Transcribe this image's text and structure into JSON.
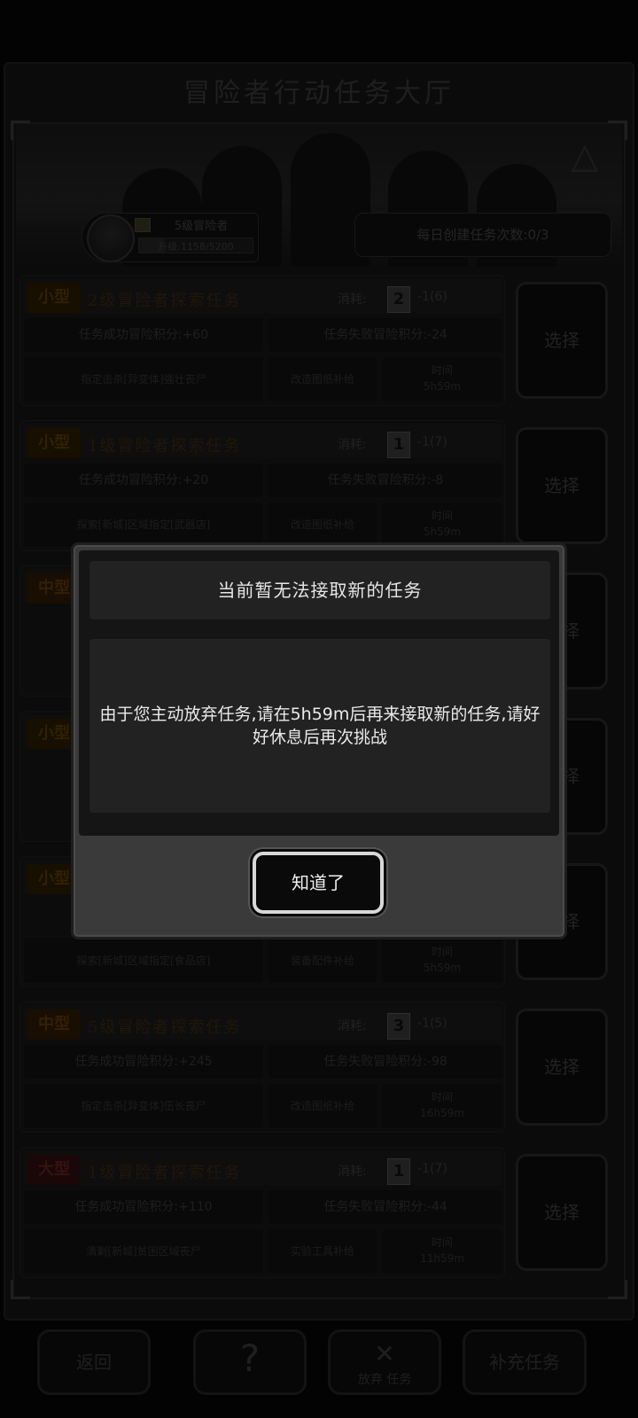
{
  "header": {
    "title": "冒险者行动任务大厅"
  },
  "player": {
    "rank": "5级冒险者",
    "exp_text": "升级:1158/5200",
    "exp_fraction": 0.22,
    "daily_label": "每日创建任务次数:0/3"
  },
  "tasks": [
    {
      "type": "小型",
      "name": "2级冒险者探索任务",
      "cost_label": "消耗:",
      "card": "2",
      "cost": "-1(6)",
      "success": "任务成功冒险积分:+60",
      "fail": "任务失败冒险积分:-24",
      "location": "指定击杀[异变体]强壮丧尸",
      "reward": "改造图纸补给",
      "time_label": "时间",
      "time": "5h59m",
      "select": "选择"
    },
    {
      "type": "小型",
      "name": "1级冒险者探索任务",
      "cost_label": "消耗:",
      "card": "1",
      "cost": "-1(7)",
      "success": "任务成功冒险积分:+20",
      "fail": "任务失败冒险积分:-8",
      "location": "探索[新城]区域指定[武器店]",
      "reward": "改造图纸补给",
      "time_label": "时间",
      "time": "5h59m",
      "select": "选择"
    },
    {
      "type": "中型",
      "select": "选择"
    },
    {
      "type": "小型",
      "select": "选择"
    },
    {
      "type": "小型",
      "location": "探索[新城]区域指定[食品店]",
      "reward": "装备配件补给",
      "time_label": "时间",
      "time": "5h59m",
      "select": "选择"
    },
    {
      "type": "中型",
      "name": "5级冒险者探索任务",
      "cost_label": "消耗:",
      "card": "3",
      "cost": "-1(5)",
      "success": "任务成功冒险积分:+245",
      "fail": "任务失败冒险积分:-98",
      "location": "指定击杀[异变体]伍长丧尸",
      "reward": "改造图纸补给",
      "time_label": "时间",
      "time": "16h59m",
      "select": "选择"
    },
    {
      "type": "大型",
      "name": "1级冒险者探索任务",
      "cost_label": "消耗:",
      "card": "1",
      "cost": "-1(7)",
      "success": "任务成功冒险积分:+110",
      "fail": "任务失败冒险积分:-44",
      "location": "清剿[新城]贫困区域丧尸",
      "reward": "实验工具补给",
      "time_label": "时间",
      "time": "11h59m",
      "select": "选择"
    }
  ],
  "bottom": {
    "back": "返回",
    "help_icon": "?",
    "abandon_icon": "✕",
    "abandon": "放弃 任务",
    "extra": "补充任务"
  },
  "dialog": {
    "title": "当前暂无法接取新的任务",
    "message": "由于您主动放弃任务,请在5h59m后再来接取新的任务,请好好休息后再次挑战",
    "ok": "知道了"
  },
  "colors": {
    "dialog_bg": "#3a3a3a",
    "dialog_text": "#eaeaea",
    "ok_border": "#d8d8d8"
  }
}
